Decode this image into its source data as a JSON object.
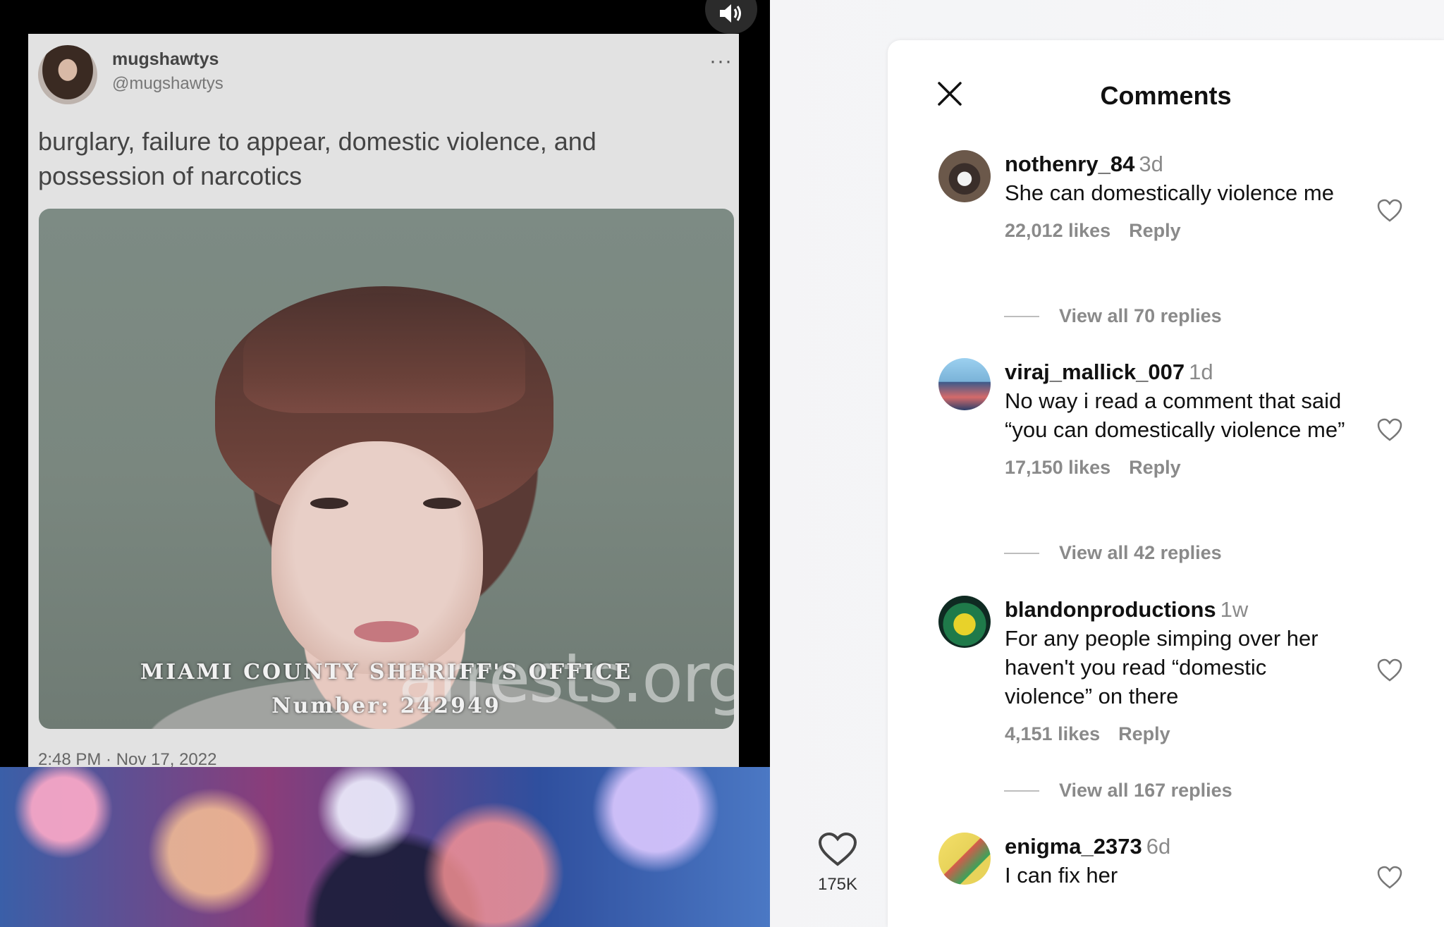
{
  "tweet": {
    "name": "mugshawtys",
    "handle": "@mugshawtys",
    "more": "···",
    "text": "burglary, failure to appear, domestic violence, and possession of narcotics",
    "caption_line1": "MIAMI  COUNTY  SHERIFF'S  OFFICE",
    "caption_line2": "Number:  242949",
    "watermark": "arrests.org",
    "timestamp": "2:48 PM · Nov 17, 2022"
  },
  "reel": {
    "likes": "175K",
    "mute_icon": "speaker-on-icon"
  },
  "comments_panel": {
    "title": "Comments",
    "comments": [
      {
        "user": "nothenry_84",
        "age": "3d",
        "text": "She can domestically violence me",
        "likes": "22,012 likes",
        "reply": "Reply",
        "view_replies": "View all 70 replies",
        "avatar_color": "#5b4a3f"
      },
      {
        "user": "viraj_mallick_007",
        "age": "1d",
        "text": "No way i read a comment that said “you can domestically violence me”",
        "likes": "17,150 likes",
        "reply": "Reply",
        "view_replies": "View all 42 replies",
        "avatar_color": "#7ab3d8"
      },
      {
        "user": "blandonproductions",
        "age": "1w",
        "text": "For any people simping over her haven't you read “domestic violence” on there",
        "likes": "4,151 likes",
        "reply": "Reply",
        "view_replies": "View all 167 replies",
        "avatar_color": "#1d4a3a"
      },
      {
        "user": "enigma_2373",
        "age": "6d",
        "text": "I can fix her",
        "avatar_color": "#e8d35a"
      }
    ]
  }
}
